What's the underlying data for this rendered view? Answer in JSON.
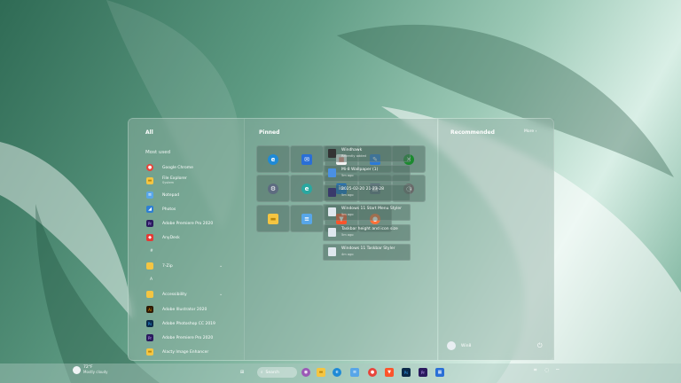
{
  "colors": {
    "accent": "#2b8a68",
    "tile": "#5d8074"
  },
  "all": {
    "title": "All",
    "most_used": "Most used",
    "apps": [
      {
        "label": "Google Chrome",
        "sub": "",
        "icon": "chrome-icon",
        "color": "#e8453c",
        "glyph": "●"
      },
      {
        "label": "File Explorer",
        "sub": "System",
        "icon": "folder-icon",
        "color": "#f4c542",
        "glyph": "▬"
      },
      {
        "label": "Notepad",
        "sub": "",
        "icon": "notepad-icon",
        "color": "#58a6e8",
        "glyph": "≡"
      },
      {
        "label": "Photos",
        "sub": "",
        "icon": "photos-icon",
        "color": "#2d7fd3",
        "glyph": "◢"
      },
      {
        "label": "Adobe Premiere Pro 2020",
        "sub": "",
        "icon": "premiere-icon",
        "color": "#2a1a5e",
        "glyph": "Pr"
      },
      {
        "label": "AnyDesk",
        "sub": "",
        "icon": "anydesk-icon",
        "color": "#e53935",
        "glyph": "◆"
      }
    ],
    "letter_hash": "#",
    "group_7zip": "7-Zip",
    "letter_a": "A",
    "group_accessibility": "Accessibility",
    "apps2": [
      {
        "label": "Adobe Illustrator 2020",
        "icon": "illustrator-icon",
        "color": "#2e1a05",
        "glyph": "Ai"
      },
      {
        "label": "Adobe Photoshop CC 2019",
        "icon": "photoshop-icon",
        "color": "#0b2a4a",
        "glyph": "Ps"
      },
      {
        "label": "Adobe Premiere Pro 2020",
        "icon": "premiere-icon",
        "color": "#2a1a5e",
        "glyph": "Pr"
      },
      {
        "label": "Alacty Image Enhancer",
        "icon": "folder-icon",
        "color": "#f4c542",
        "glyph": "▬"
      }
    ]
  },
  "pinned": {
    "title": "Pinned",
    "tiles": [
      {
        "icon": "edge-icon",
        "color": "#1f8ad6",
        "glyph": "e"
      },
      {
        "icon": "mail-icon",
        "color": "#2a6fd6",
        "glyph": "✉"
      },
      {
        "icon": "store-icon",
        "color": "#f2f2f2",
        "glyph": "▦"
      },
      {
        "icon": "pen-icon",
        "color": "#2c7ad6",
        "glyph": "✎"
      },
      {
        "icon": "xbox-icon",
        "color": "#1b8a2f",
        "glyph": "✕"
      },
      {
        "icon": "settings-icon",
        "color": "#5d6b80",
        "glyph": "⚙"
      },
      {
        "icon": "edge-beta-icon",
        "color": "#2aa7a0",
        "glyph": "e"
      },
      {
        "icon": "linkedin-icon",
        "color": "#0a66c2",
        "glyph": "in"
      },
      {
        "icon": "calculator-icon",
        "color": "#5a6d7c",
        "glyph": "▤"
      },
      {
        "icon": "clock-icon",
        "color": "#6a6a6a",
        "glyph": "◷"
      },
      {
        "icon": "folder-icon",
        "color": "#f4c542",
        "glyph": "▬"
      },
      {
        "icon": "notepad-icon",
        "color": "#58a6e8",
        "glyph": "≡"
      },
      {
        "icon": "brave-icon",
        "color": "#fb542b",
        "glyph": "▼"
      },
      {
        "icon": "firefox-icon",
        "color": "#ff7139",
        "glyph": "●"
      }
    ]
  },
  "recommended": {
    "title": "Recommended",
    "more": "More",
    "items": [
      {
        "title": "Windhawk",
        "sub": "Recently added",
        "icon": "windhawk-icon"
      },
      {
        "title": "Mi-8 Wallpaper (1)",
        "sub": "5m ago",
        "icon": "image-file-icon"
      },
      {
        "title": "2025-02-20 21-23-28",
        "sub": "5m ago",
        "icon": "video-file-icon"
      },
      {
        "title": "Windows 11 Start Menu Styler",
        "sub": "5m ago",
        "icon": "document-icon"
      },
      {
        "title": "Taskbar height and icon size",
        "sub": "5m ago",
        "icon": "document-icon"
      },
      {
        "title": "Windows 11 Taskbar Styler",
        "sub": "4m ago",
        "icon": "document-icon"
      }
    ]
  },
  "user": {
    "name": "Win8"
  },
  "taskbar": {
    "weather_temp": "72°F",
    "weather_desc": "Mostly cloudy",
    "search": "Search",
    "icons": [
      {
        "icon": "start-icon",
        "color": "#3aa0e0",
        "glyph": "⊞"
      },
      {
        "icon": "search-icon",
        "color": "#888",
        "glyph": "⌕"
      },
      {
        "icon": "taskview-icon",
        "color": "#555",
        "glyph": "▣"
      },
      {
        "icon": "copilot-icon",
        "color": "#9b59b6",
        "glyph": "◉"
      },
      {
        "icon": "folder-icon",
        "color": "#f4c542",
        "glyph": "▬"
      },
      {
        "icon": "edge-icon",
        "color": "#1f8ad6",
        "glyph": "e"
      },
      {
        "icon": "notepad-icon",
        "color": "#58a6e8",
        "glyph": "≡"
      },
      {
        "icon": "chrome-icon",
        "color": "#e8453c",
        "glyph": "●"
      },
      {
        "icon": "brave-icon",
        "color": "#fb542b",
        "glyph": "▼"
      },
      {
        "icon": "photoshop-icon",
        "color": "#0b2a4a",
        "glyph": "Ps"
      },
      {
        "icon": "premiere-icon",
        "color": "#2a1a5e",
        "glyph": "Pr"
      },
      {
        "icon": "store-icon",
        "color": "#2a6fd6",
        "glyph": "▦"
      }
    ]
  }
}
